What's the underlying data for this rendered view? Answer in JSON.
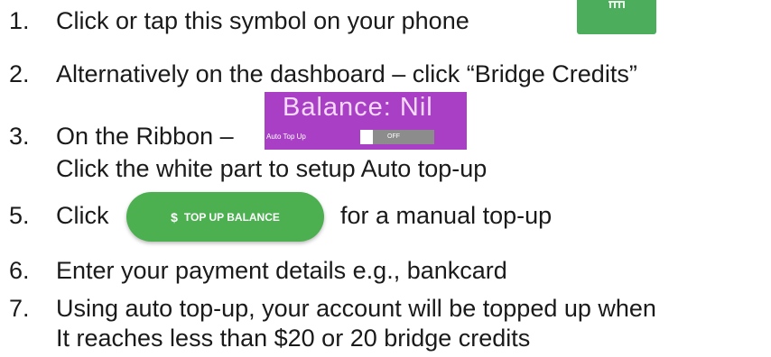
{
  "steps": [
    {
      "num": "1.",
      "text": "Click or tap this symbol on your phone"
    },
    {
      "num": "2.",
      "text": "Alternatively on the dashboard – click “Bridge Credits”"
    },
    {
      "num": "3.",
      "text": "On the Ribbon –",
      "continuation": "Click the white part to setup Auto top-up"
    },
    {
      "num": "5.",
      "text": "Click",
      "after": "for a manual top-up"
    },
    {
      "num": "6.",
      "text": "Enter your payment details e.g., bankcard"
    },
    {
      "num": "7.",
      "text": "Using auto top-up, your account will be topped up when",
      "continuation": "It reaches less than $20 or 20 bridge credits"
    }
  ],
  "ribbon": {
    "balance": "Balance: Nil",
    "auto_top_up_label": "Auto Top Up",
    "toggle_state": "OFF"
  },
  "topup_button": {
    "icon": "$",
    "label": "TOP UP BALANCE"
  },
  "phone_symbol": {
    "icon": "bank-icon"
  },
  "colors": {
    "green": "#4caf50",
    "purple": "#a83fc4",
    "toggle_gray": "#8c8c8c"
  }
}
